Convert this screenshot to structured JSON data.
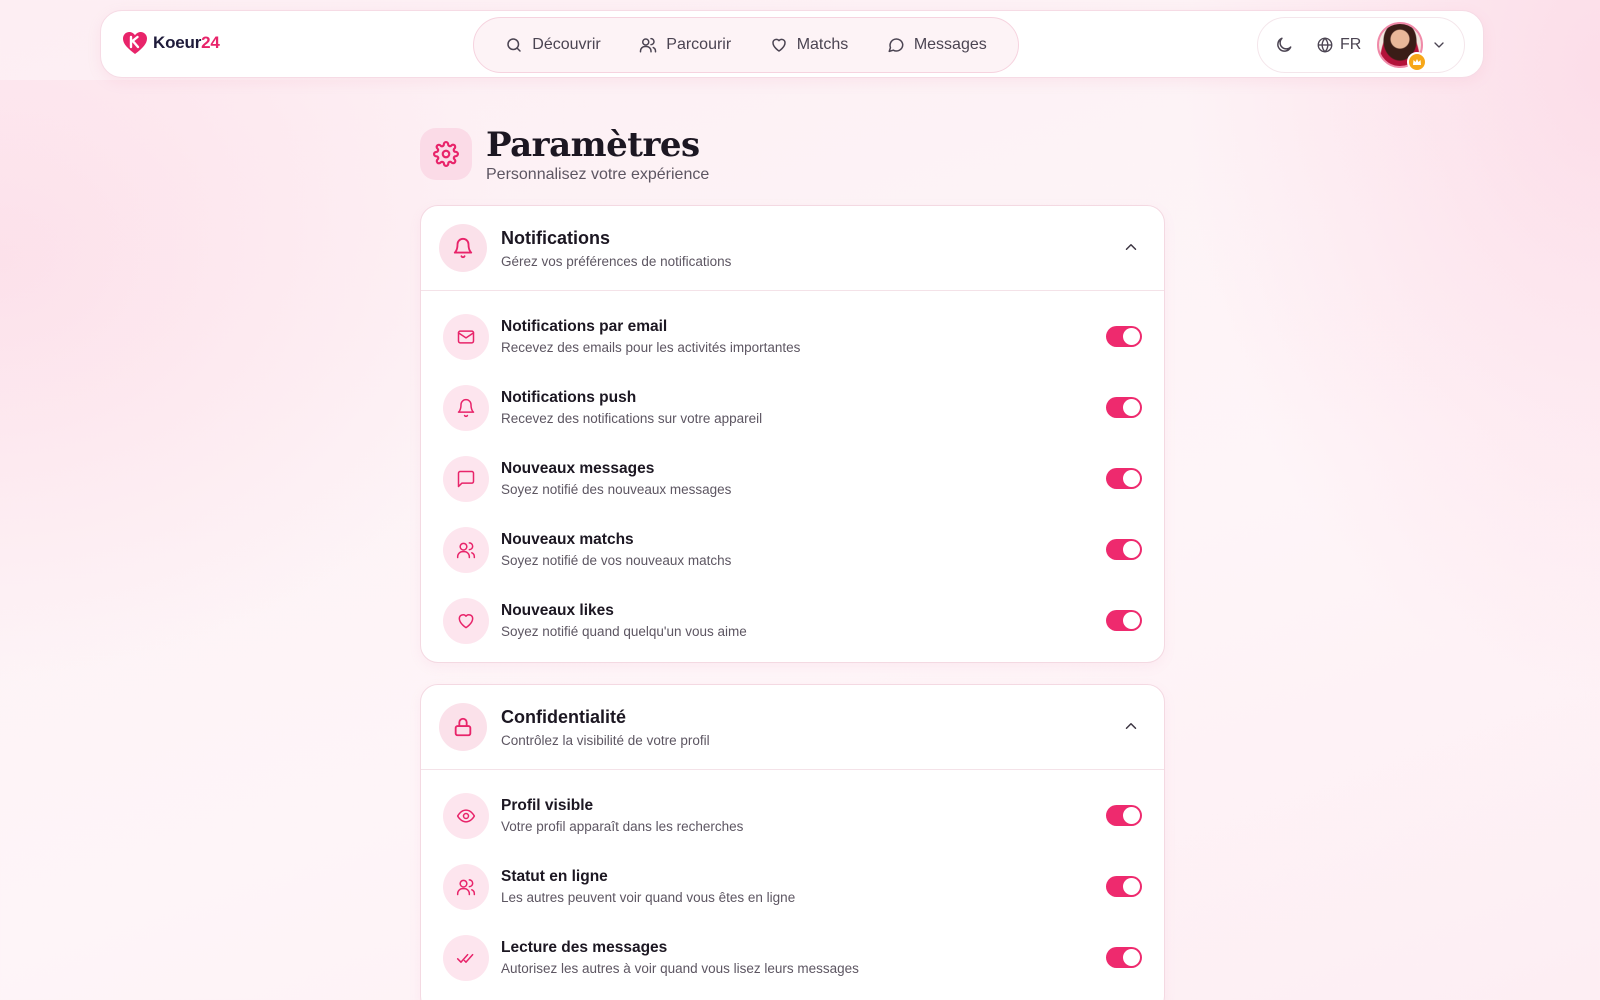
{
  "brand": {
    "name": "Koeur",
    "suffix": "24",
    "color": "#e8246a"
  },
  "nav": {
    "discover": "Découvrir",
    "browse": "Parcourir",
    "matches": "Matchs",
    "messages": "Messages"
  },
  "header_right": {
    "language": "FR"
  },
  "page": {
    "title": "Paramètres",
    "subtitle": "Personnalisez votre expérience"
  },
  "notifications": {
    "title": "Notifications",
    "subtitle": "Gérez vos préférences de notifications",
    "items": [
      {
        "title": "Notifications par email",
        "subtitle": "Recevez des emails pour les activités importantes",
        "icon": "mail-icon",
        "enabled": true
      },
      {
        "title": "Notifications push",
        "subtitle": "Recevez des notifications sur votre appareil",
        "icon": "bell-icon",
        "enabled": true
      },
      {
        "title": "Nouveaux messages",
        "subtitle": "Soyez notifié des nouveaux messages",
        "icon": "message-square-icon",
        "enabled": true
      },
      {
        "title": "Nouveaux matchs",
        "subtitle": "Soyez notifié de vos nouveaux matchs",
        "icon": "users-icon",
        "enabled": true
      },
      {
        "title": "Nouveaux likes",
        "subtitle": "Soyez notifié quand quelqu'un vous aime",
        "icon": "heart-icon",
        "enabled": true
      }
    ]
  },
  "privacy": {
    "title": "Confidentialité",
    "subtitle": "Contrôlez la visibilité de votre profil",
    "items": [
      {
        "title": "Profil visible",
        "subtitle": "Votre profil apparaît dans les recherches",
        "icon": "eye-icon",
        "enabled": true
      },
      {
        "title": "Statut en ligne",
        "subtitle": "Les autres peuvent voir quand vous êtes en ligne",
        "icon": "users-icon",
        "enabled": true
      },
      {
        "title": "Lecture des messages",
        "subtitle": "Autorisez les autres à voir quand vous lisez leurs messages",
        "icon": "check-check-icon",
        "enabled": true
      }
    ]
  }
}
